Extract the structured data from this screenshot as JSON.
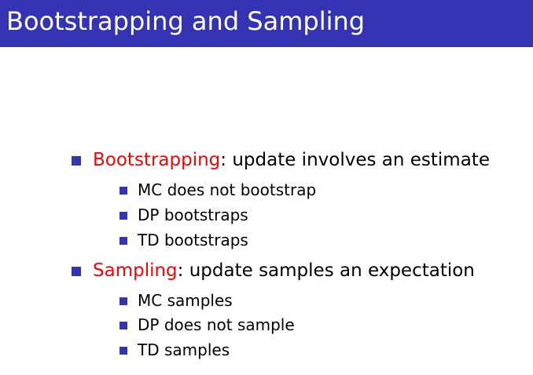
{
  "slide": {
    "title": "Bootstrapping and Sampling"
  },
  "colors": {
    "title_bar": "#3333b3",
    "bullet": "#3333b3",
    "term": "#ff0000"
  },
  "items": [
    {
      "term": "Bootstrapping",
      "rest": ": update involves an estimate",
      "subitems": [
        "MC does not bootstrap",
        "DP bootstraps",
        "TD bootstraps"
      ]
    },
    {
      "term": "Sampling",
      "rest": ": update samples an expectation",
      "subitems": [
        "MC samples",
        "DP does not sample",
        "TD samples"
      ]
    }
  ]
}
